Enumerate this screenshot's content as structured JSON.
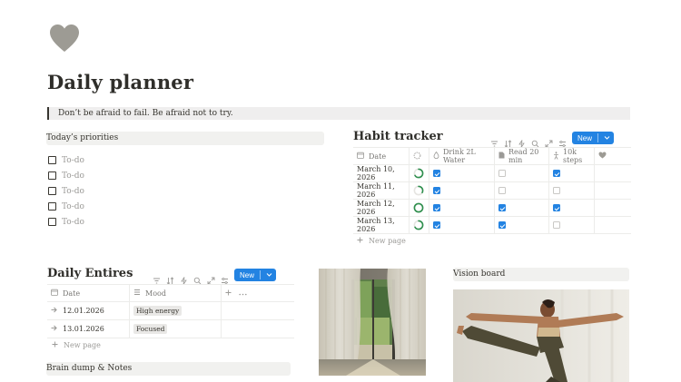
{
  "page": {
    "icon": "heart-icon",
    "title": "Daily planner",
    "quote": "Don’t be afraid to fail. Be afraid not to try."
  },
  "priorities": {
    "header": "Today’s priorities",
    "items": [
      "To-do",
      "To-do",
      "To-do",
      "To-do",
      "To-do"
    ]
  },
  "habit_tracker": {
    "title": "Habit tracker",
    "new_label": "New",
    "columns": {
      "date": "Date",
      "progress": "",
      "water": "Drink 2L Water",
      "read": "Read 20 min",
      "steps": "10k steps"
    },
    "rows": [
      {
        "date": "March 10, 2026",
        "progress": 0.66,
        "water": true,
        "read": false,
        "steps": true
      },
      {
        "date": "March 11, 2026",
        "progress": 0.33,
        "water": true,
        "read": false,
        "steps": false
      },
      {
        "date": "March 12, 2026",
        "progress": 1.0,
        "water": true,
        "read": true,
        "steps": true
      },
      {
        "date": "March 13, 2026",
        "progress": 0.66,
        "water": true,
        "read": true,
        "steps": false
      }
    ],
    "new_page": "New page"
  },
  "daily_entries": {
    "title": "Daily Entires",
    "new_label": "New",
    "columns": {
      "date": "Date",
      "mood": "Mood"
    },
    "rows": [
      {
        "date": "12.01.2026",
        "mood": "High energy"
      },
      {
        "date": "13.01.2026",
        "mood": "Focused"
      }
    ],
    "new_page": "New page"
  },
  "brain_dump": {
    "header": "Brain dump & Notes"
  },
  "vision_board": {
    "header": "Vision board"
  },
  "colors": {
    "accent": "#2383e2",
    "progress": "#2f8f4e",
    "text": "#37352f",
    "muted": "#9b9a97",
    "header_bg": "#f1f1ef"
  }
}
